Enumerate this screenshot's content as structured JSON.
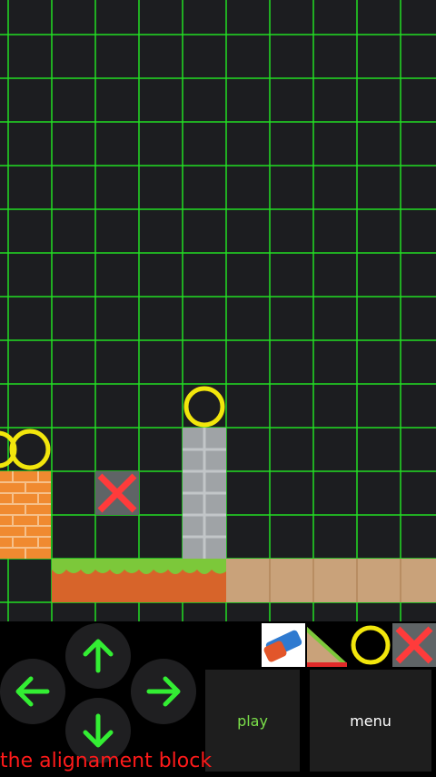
{
  "colors": {
    "grid": "#22dd22",
    "background": "#1c1d20",
    "ring": "#f2e60c",
    "brick": "#f08a30",
    "stone": "#9fa3a6",
    "grass": "#7cc83a",
    "dirt": "#d7642a",
    "sand": "#c9a27a",
    "cross": "#ff3b3b",
    "status_text": "#ff1a1a"
  },
  "palette": [
    {
      "name": "eraser-tool",
      "icon": "eraser-icon"
    },
    {
      "name": "slope-tool",
      "icon": "slope-icon"
    },
    {
      "name": "ring-tool",
      "icon": "ring-icon"
    },
    {
      "name": "cross-tool",
      "icon": "cross-icon"
    }
  ],
  "dpad": {
    "up": "up-arrow-icon",
    "left": "left-arrow-icon",
    "right": "right-arrow-icon",
    "down": "down-arrow-icon"
  },
  "buttons": {
    "play": "play",
    "menu": "menu"
  },
  "status": "the alignament block"
}
